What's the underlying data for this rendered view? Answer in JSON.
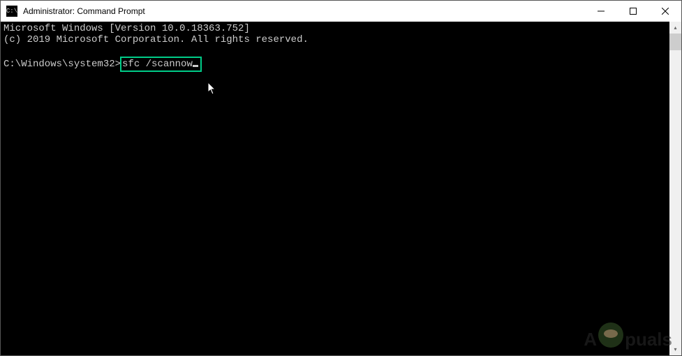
{
  "titlebar": {
    "icon_label": "C:\\",
    "title": "Administrator: Command Prompt"
  },
  "terminal": {
    "line1": "Microsoft Windows [Version 10.0.18363.752]",
    "line2": "(c) 2019 Microsoft Corporation. All rights reserved.",
    "prompt": "C:\\Windows\\system32>",
    "command": "sfc /scannow"
  },
  "watermark": {
    "prefix": "A",
    "suffix": "puals"
  }
}
